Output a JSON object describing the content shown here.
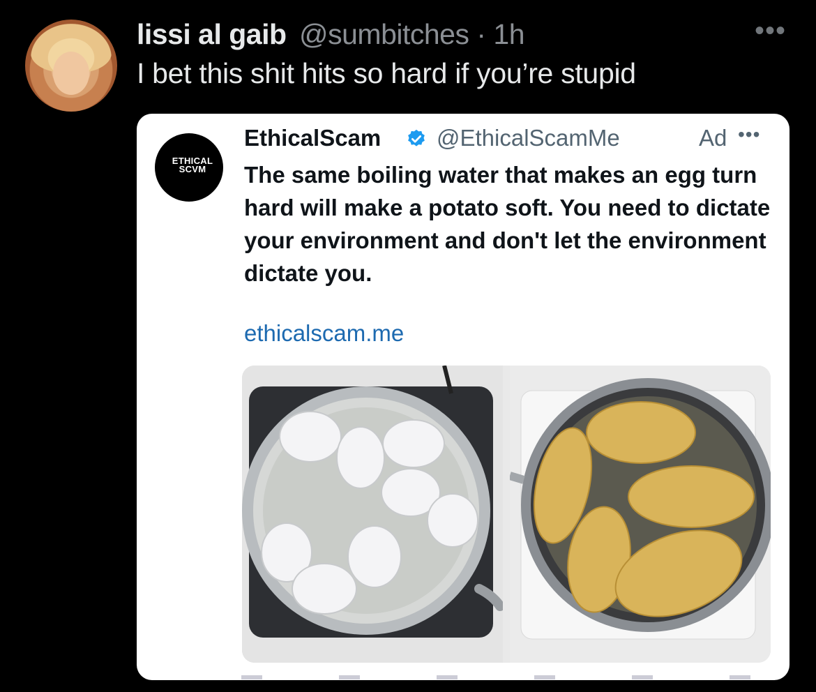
{
  "tweet": {
    "display_name": "lissi al gaib",
    "handle_time": "@sumbitches · 1h",
    "text": "I bet this shit hits so hard if you’re stupid",
    "more_icon": "more-horizontal-icon"
  },
  "ad_card": {
    "avatar_text": "ETHICAL SCVM",
    "name": "EthicalScam",
    "verified_icon": "verified-badge-icon",
    "verified_color": "#1d9bf0",
    "handle": "@EthicalScamMe",
    "ad_label": "Ad",
    "more_icon": "more-horizontal-icon",
    "text": "The same boiling water that makes an egg turn hard will make a potato soft. You need to dictate your environment and don't let the environment dictate you.",
    "link": "ethicalscam.me",
    "link_color": "#1d6ab0",
    "media": [
      {
        "subject": "eggs-boiling-in-pot"
      },
      {
        "subject": "potatoes-boiled-in-pot"
      }
    ]
  },
  "colors": {
    "background": "#000000",
    "primary_text": "#e7e9ea",
    "secondary_text": "#8b8f94",
    "card_background": "#ffffff"
  }
}
